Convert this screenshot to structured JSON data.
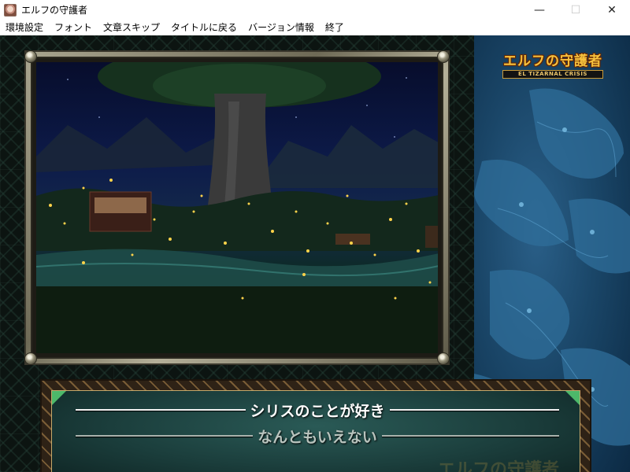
{
  "window": {
    "title": "エルフの守護者",
    "controls": {
      "minimize": "—",
      "maximize": "☐",
      "close": "✕"
    }
  },
  "menu": {
    "items": [
      "環境設定",
      "フォント",
      "文章スキップ",
      "タイトルに戻る",
      "バージョン情報",
      "終了"
    ]
  },
  "logo": {
    "title": "エルフの守護者",
    "subtitle": "EL TIZARNAL CRISIS"
  },
  "dialog": {
    "choices": [
      {
        "label": "シリスのことが好き",
        "selected": true
      },
      {
        "label": "なんともいえない",
        "selected": false
      }
    ],
    "watermark": "エルフの守護者"
  },
  "colors": {
    "map_sea": "#1a4668",
    "dialog_panel": "#1b3e3c",
    "gold": "#f6c23e",
    "corner_green": "#4db86a"
  },
  "icons": {
    "app": "elf-portrait-icon",
    "minimize": "minimize-icon",
    "maximize": "maximize-icon",
    "close": "close-icon"
  }
}
